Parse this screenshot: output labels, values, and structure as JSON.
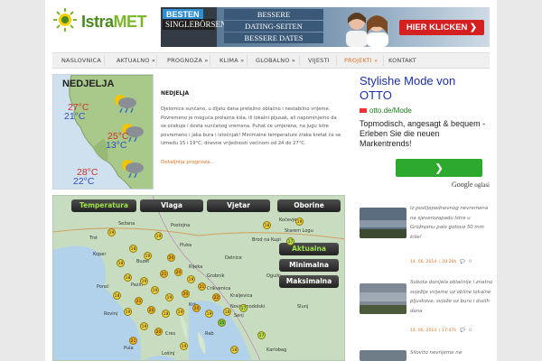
{
  "header": {
    "logo_text_a": "Istra",
    "logo_text_b": "MET",
    "banner": {
      "besten": "BESTEN",
      "singles": "SINGLEBÖRSEN",
      "line1": "BESSERE",
      "line2": "DATING-SEITEN",
      "line3": "BESSERE DATES",
      "cta": "HIER KLICKEN ❯"
    }
  },
  "nav": {
    "items": [
      {
        "label": "NASLOVNICA"
      },
      {
        "label": "AKTUALNO »"
      },
      {
        "label": "PROGNOZA »"
      },
      {
        "label": "KLIMA »"
      },
      {
        "label": "GLOBALNO »"
      },
      {
        "label": "VIJESTI"
      },
      {
        "label": "PROJEKTI »"
      },
      {
        "label": "KONTAKT"
      }
    ]
  },
  "forecast": {
    "day": "NEDJELJA",
    "temps": {
      "t1_hi": "27°C",
      "t1_lo": "21°C",
      "t2_hi": "25°C",
      "t2_lo": "13°C",
      "t3_hi": "28°C",
      "t3_lo": "22°C"
    },
    "title": "NEDJELJA",
    "text": "Djelomice sunčano, u dijelu dana pretežno oblačno i nestabilno vrijeme. Povremeno je moguća prolazna kiša, ili lokalni pljusak, ali napominjemo da se očekuje i dosta sunčanog vremena. Puhat će umjerena, na jugu istre povremeno i jaka bura i istočnjak! Minimalne temperature zraka kretat će se između 15 i 19°C, dnevne vrijednosti većinom od 24 do 27°C.",
    "link": "Detaljnija prognoza..."
  },
  "ad": {
    "title": "Stylishe Mode von OTTO",
    "url": "otto.de/Mode",
    "desc": "Topmodisch, angesagt & bequem - Erleben Sie die neuen Markentrends!",
    "btn": "❯",
    "google": "Google",
    "oglasi": "oglasi"
  },
  "map": {
    "tabs": {
      "t1": "Temperatura",
      "t2": "Vlaga",
      "t3": "Vjetar",
      "t4": "Oborine"
    },
    "options": {
      "o1": "Aktualna",
      "o2": "Minimalna",
      "o3": "Maksimalna"
    },
    "cities": {
      "c1": "Sežana",
      "c2": "Postojna",
      "c3": "Kočevje",
      "c4": "Pivka",
      "c5": "Trst",
      "c6": "Koper",
      "c7": "Buzet",
      "c8": "Pazin",
      "c9": "Poreč",
      "c10": "Rovinj",
      "c11": "Pula",
      "c12": "Rijeka",
      "c13": "Delnice",
      "c14": "Crikvenica",
      "c15": "Senj",
      "c16": "Krk",
      "c17": "Rab",
      "c18": "Kraljevica",
      "c19": "Ogulin",
      "c20": "Brod na Kupi",
      "c21": "Novi Vinodolski",
      "c22": "Cres",
      "c23": "Lošinj",
      "c24": "Starem Logu",
      "c25": "Grobnik",
      "c26": "Slunj",
      "c27": "Karlobag"
    },
    "dots": {
      "d1": "19",
      "d2": "19",
      "d3": "18",
      "d4": "17",
      "d5": "19",
      "d6": "18",
      "d7": "19",
      "d8": "20",
      "d9": "18",
      "d10": "21",
      "d11": "20",
      "d12": "19",
      "d13": "18",
      "d14": "19",
      "d15": "21",
      "d16": "19",
      "d17": "18",
      "d18": "19",
      "d19": "20",
      "d20": "22",
      "d21": "21",
      "d22": "20",
      "d23": "19",
      "d24": "18",
      "d25": "19",
      "d26": "20",
      "d27": "19",
      "d28": "18",
      "d29": "15",
      "d30": "17",
      "d31": "19",
      "d32": "20",
      "d33": "21",
      "d34": "17",
      "d35": "19",
      "d36": "18"
    }
  },
  "news": {
    "items": [
      {
        "text": "Iz poslijepodnevnog nevremena na sjeverozapadu Istre u Grožnjanu palo gotovo 50 mm kiše!",
        "date": "14. 06. 2014. | 20:26h",
        "count": "0"
      },
      {
        "text": "Subota donijela oblačnije i znatno svježije vrijeme uz obilne lokalne pljuskove, svježe uz buru i dućih dana",
        "date": "14. 06. 2014. | 17:47h",
        "count": "0"
      },
      {
        "text": "Silovito nevrijeme na"
      }
    ]
  },
  "colors": {
    "accent": "#e07020",
    "green": "#7ab82a",
    "map_green": "#9ee44a"
  }
}
